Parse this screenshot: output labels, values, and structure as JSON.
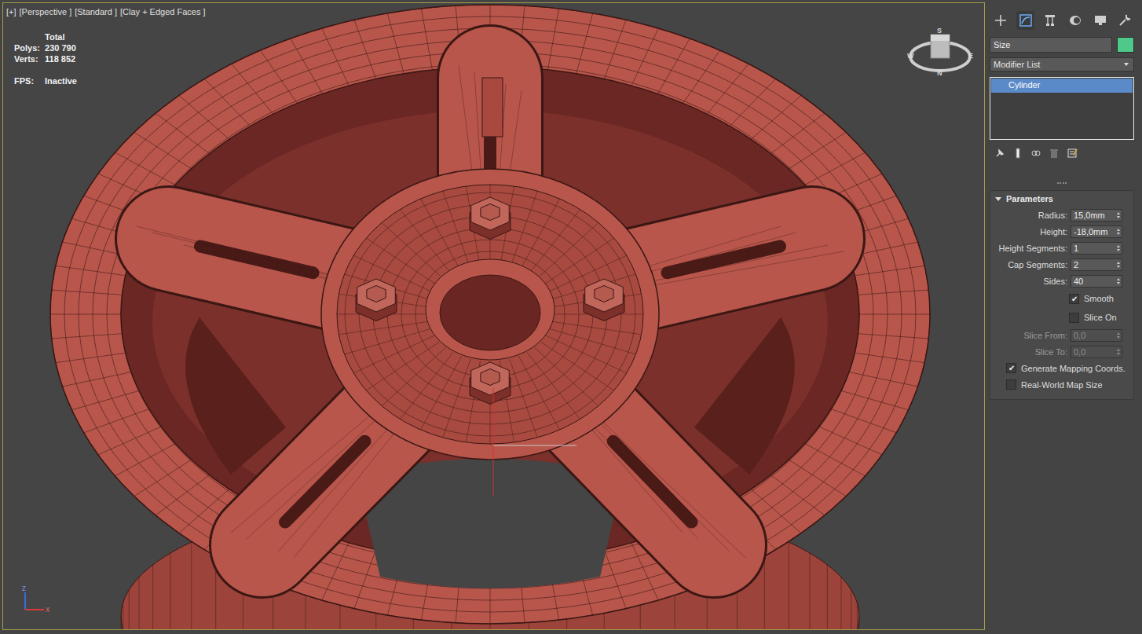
{
  "viewport": {
    "labels": [
      "[+]",
      "[Perspective ]",
      "[Standard ]",
      "[Clay + Edged Faces ]"
    ],
    "stats": {
      "header": "Total",
      "rows": [
        {
          "label": "Polys:",
          "value": "230 790"
        },
        {
          "label": "Verts:",
          "value": "118 852"
        }
      ],
      "fps": {
        "label": "FPS:",
        "value": "Inactive"
      }
    },
    "compass": {
      "north": "N",
      "south": "S",
      "east": "E",
      "west": "W"
    },
    "axes": [
      "z",
      "x"
    ]
  },
  "command_panel": {
    "tabs": [
      {
        "kind": "create",
        "selected": false
      },
      {
        "kind": "modify",
        "selected": true
      },
      {
        "kind": "hierarchy",
        "selected": false
      },
      {
        "kind": "motion",
        "selected": false
      },
      {
        "kind": "display",
        "selected": false
      },
      {
        "kind": "utilities",
        "selected": false
      }
    ],
    "name_field": {
      "value": "Size",
      "color": "#4ec98a"
    },
    "modifier_list": {
      "label": "Modifier List"
    },
    "stack": [
      {
        "label": "Cylinder",
        "selected": true
      }
    ],
    "stack_buttons": [
      {
        "kind": "pin",
        "disabled": false
      },
      {
        "kind": "show-end",
        "disabled": false
      },
      {
        "kind": "make-unique",
        "disabled": false
      },
      {
        "kind": "remove",
        "disabled": true
      },
      {
        "kind": "configure",
        "disabled": false
      }
    ],
    "rollout": {
      "title": "Parameters",
      "expanded": true,
      "rows": [
        {
          "kind": "spinner",
          "label": "Radius:",
          "value": "15,0mm",
          "disabled": false
        },
        {
          "kind": "spinner",
          "label": "Height:",
          "value": "-18,0mm",
          "disabled": false
        },
        {
          "kind": "spinner",
          "label": "Height Segments:",
          "value": "1",
          "disabled": false
        },
        {
          "kind": "spinner",
          "label": "Cap Segments:",
          "value": "2",
          "disabled": false
        },
        {
          "kind": "spinner",
          "label": "Sides:",
          "value": "40",
          "disabled": false
        },
        {
          "kind": "option",
          "label": "Smooth",
          "checked": true,
          "disabled": false
        },
        {
          "kind": "option",
          "label": "Slice On",
          "checked": false,
          "disabled": false
        },
        {
          "kind": "spinner",
          "label": "Slice From:",
          "value": "0,0",
          "disabled": true
        },
        {
          "kind": "spinner",
          "label": "Slice To:",
          "value": "0,0",
          "disabled": true
        },
        {
          "kind": "checkbox",
          "label": "Generate Mapping Coords.",
          "checked": true,
          "disabled": false
        },
        {
          "kind": "checkbox",
          "label": "Real-World Map Size",
          "checked": false,
          "disabled": false
        }
      ]
    }
  }
}
